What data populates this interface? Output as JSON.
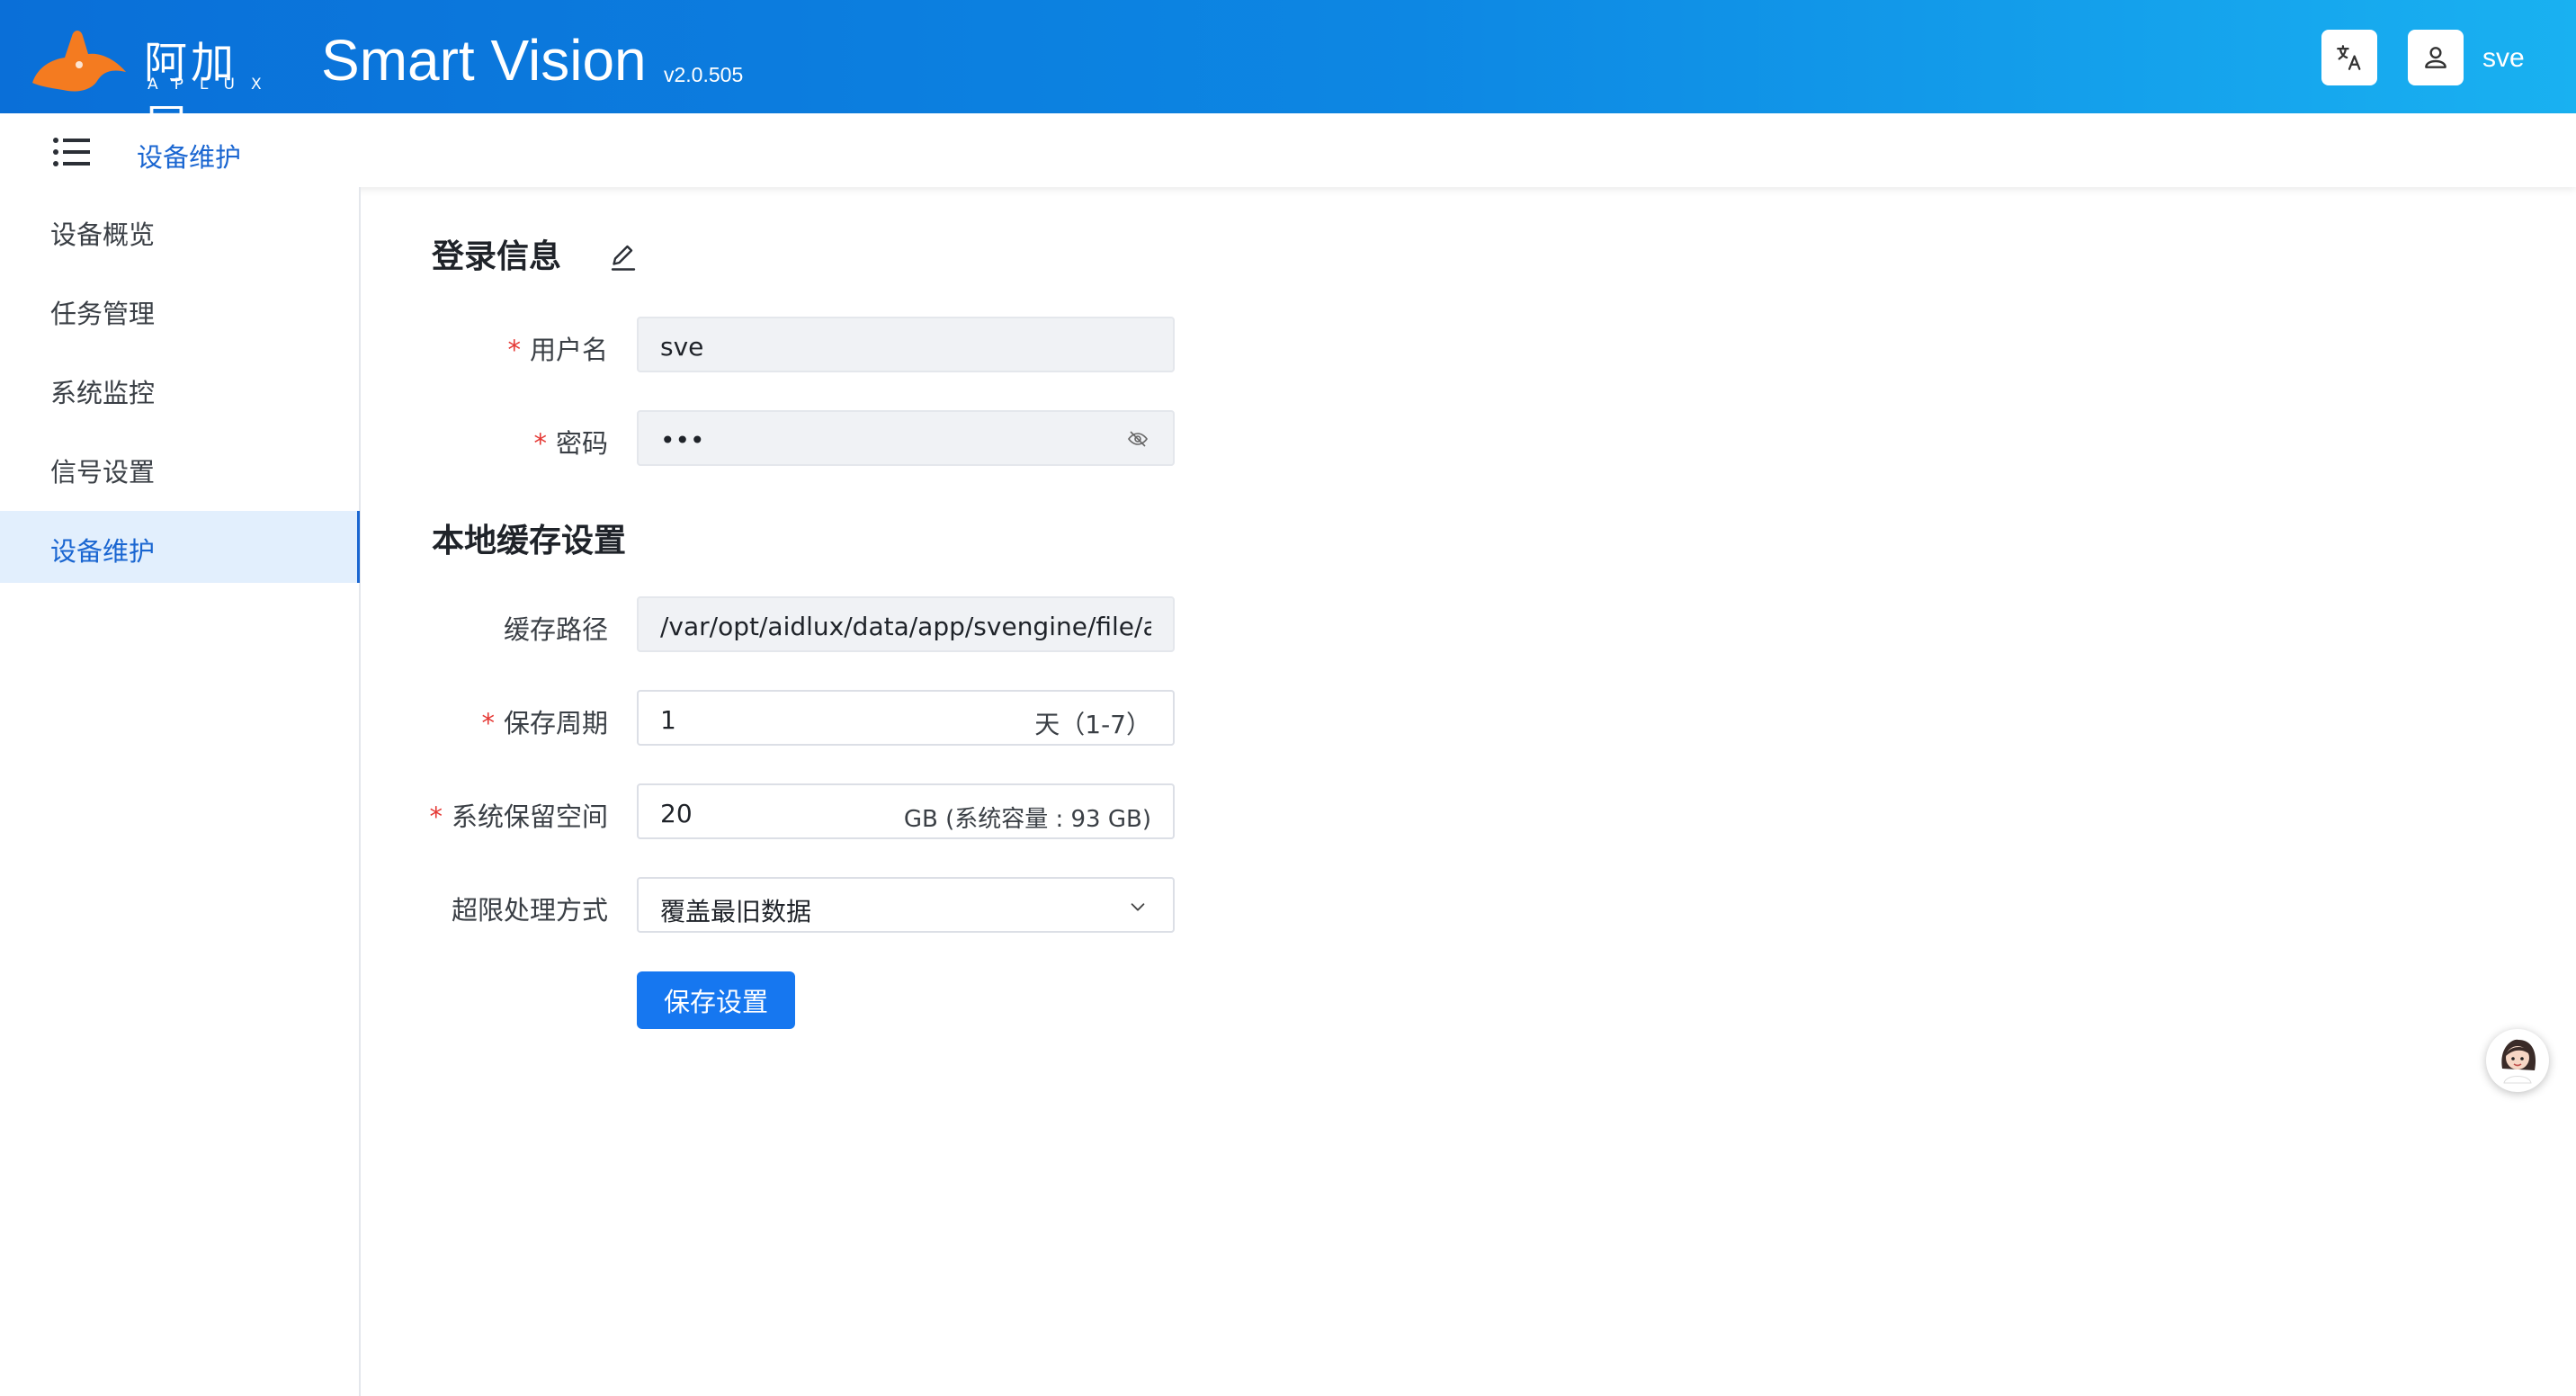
{
  "header": {
    "logo_cn": "阿加犀",
    "logo_en": "APLUX",
    "app_title": "Smart Vision",
    "version": "v2.0.505",
    "username": "sve",
    "translate_icon": "translate-icon",
    "user_icon": "user-icon"
  },
  "breadcrumb": {
    "current": "设备维护"
  },
  "sidebar": {
    "items": [
      {
        "label": "设备概览",
        "active": false
      },
      {
        "label": "任务管理",
        "active": false
      },
      {
        "label": "系统监控",
        "active": false
      },
      {
        "label": "信号设置",
        "active": false
      },
      {
        "label": "设备维护",
        "active": true
      }
    ]
  },
  "login": {
    "title": "登录信息",
    "username_label": "用户名",
    "username_value": "sve",
    "password_label": "密码",
    "password_value": "•••"
  },
  "cache": {
    "title": "本地缓存设置",
    "path_label": "缓存路径",
    "path_value": "/var/opt/aidlux/data/app/svengine/file/airesult",
    "period_label": "保存周期",
    "period_value": "1",
    "period_suffix": "天（1-7）",
    "reserve_label": "系统保留空间",
    "reserve_value": "20",
    "reserve_suffix": "GB (系统容量 : 93 GB)",
    "overflow_label": "超限处理方式",
    "overflow_value": "覆盖最旧数据",
    "save_label": "保存设置"
  },
  "colors": {
    "accent": "#1677f0",
    "header_start": "#0a6fd8",
    "header_end": "#19b1f1",
    "required": "#e53935",
    "active_bg": "#e2effd"
  }
}
